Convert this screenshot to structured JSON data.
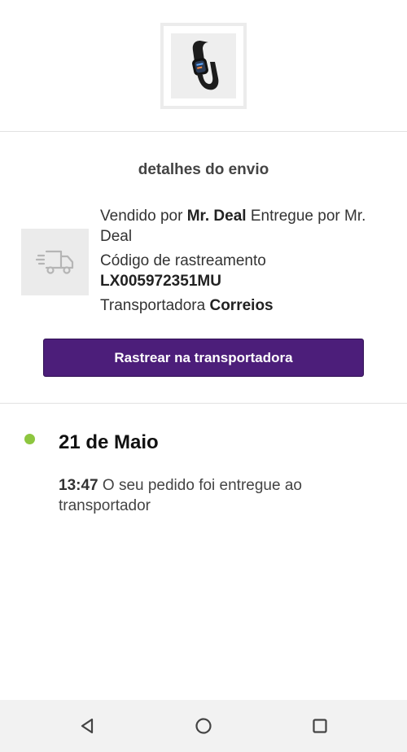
{
  "product": {
    "image_icon": "fitness-band-icon"
  },
  "shipping": {
    "title": "detalhes do envio",
    "sold_by_label": "Vendido por",
    "seller": "Mr. Deal",
    "delivered_by_label": "Entregue por",
    "deliverer": "Mr. Deal",
    "tracking_label": "Código de rastreamento",
    "tracking_code": "LX005972351MU",
    "carrier_label": "Transportadora",
    "carrier": "Correios",
    "truck_icon": "truck-icon",
    "track_button_label": "Rastrear na transportadora"
  },
  "timeline": {
    "dot_color": "#8dc63f",
    "date": "21 de Maio",
    "events": [
      {
        "time": "13:47",
        "description": "O seu pedido foi entregue ao transportador"
      }
    ]
  },
  "navbar": {
    "back_icon": "back-triangle-icon",
    "home_icon": "home-circle-icon",
    "recents_icon": "recents-square-icon"
  },
  "colors": {
    "accent": "#4c1e7a",
    "status_green": "#8dc63f"
  }
}
